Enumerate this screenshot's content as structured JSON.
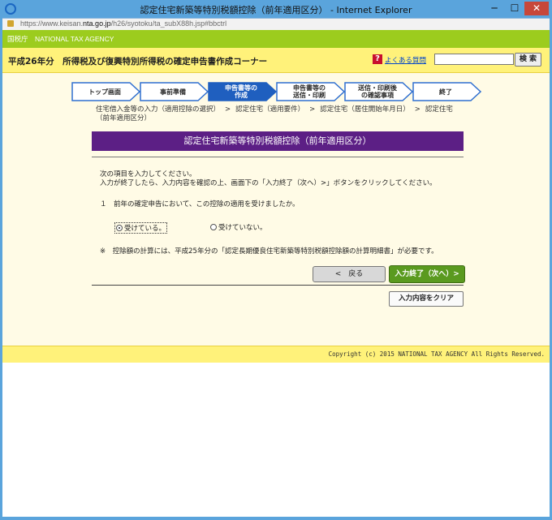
{
  "window": {
    "title": "認定住宅新築等特別税額控除（前年適用区分） - Internet Explorer",
    "controls": {
      "minimize": "─",
      "maximize": "☐",
      "close": "✕"
    }
  },
  "address": {
    "prefix": "https://www.keisan.",
    "domain": "nta.go.jp",
    "path": "/h26/syotoku/ta_subX88h.jsp#bbctrl"
  },
  "header": {
    "agency": "国税庁　NATIONAL TAX AGENCY",
    "title": "平成26年分　所得税及び復興特別所得税の確定申告書作成コーナー",
    "faq_icon": "?",
    "faq_label": "よくある質問",
    "search_button": "検 索",
    "search_value": ""
  },
  "steps": [
    {
      "line1": "トップ画面",
      "line2": "",
      "active": false
    },
    {
      "line1": "事前準備",
      "line2": "",
      "active": false
    },
    {
      "line1": "申告書等の",
      "line2": "作成",
      "active": true
    },
    {
      "line1": "申告書等の",
      "line2": "送信・印刷",
      "active": false
    },
    {
      "line1": "送信・印刷後",
      "line2": "の確認事項",
      "active": false
    },
    {
      "line1": "終了",
      "line2": "",
      "active": false
    }
  ],
  "breadcrumb": {
    "item1": "住宅借入金等の入力（適用控除の選択）",
    "item2": "認定住宅（適用要件）",
    "item3": "認定住宅（居住開始年月日）",
    "item4": "認定住宅",
    "item4b": "（前年適用区分）",
    "separator": ">"
  },
  "main": {
    "heading": "認定住宅新築等特別税額控除（前年適用区分）",
    "instruction1": "次の項目を入力してください。",
    "instruction2": "入力が終了したら、入力内容を確認の上、画面下の「入力終了（次へ）>」ボタンをクリックしてください。",
    "question": "１　前年の確定申告において、この控除の適用を受けましたか。",
    "option_yes": "受けている。",
    "option_no": "受けていない。",
    "selected": "yes",
    "note": "※　控除額の計算には、平成25年分の「認定長期優良住宅新築等特別税額控除額の計算明細書」が必要です。",
    "back_button": "<　戻る",
    "next_button": "入力終了（次へ）>",
    "clear_button": "入力内容をクリア"
  },
  "footer": {
    "copyright": "Copyright (c) 2015 NATIONAL TAX AGENCY All Rights Reserved."
  },
  "colors": {
    "green": "#9ccc1e",
    "yellow": "#fff27a",
    "purple": "#5c1f85",
    "step_active": "#1f5fbf",
    "next_button": "#5a9a1f"
  }
}
